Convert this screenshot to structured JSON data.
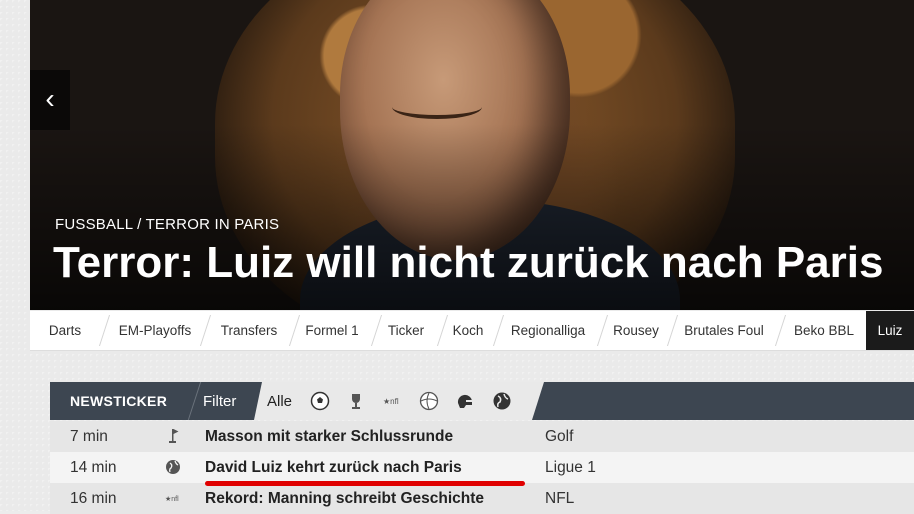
{
  "hero": {
    "prev_icon": "‹",
    "kicker": "FUSSBALL / TERROR IN PARIS",
    "title": "Terror: Luiz will nicht zurück nach Paris"
  },
  "tags": [
    "Darts",
    "EM-Playoffs",
    "Transfers",
    "Formel 1",
    "Ticker",
    "Koch",
    "Regionalliga",
    "Rousey",
    "Brutales Foul",
    "Beko BBL",
    "Luiz"
  ],
  "ticker": {
    "title": "NEWSTICKER",
    "filter_label": "Filter",
    "filter_all": "Alle",
    "filter_icons": [
      "soccer-ball-icon",
      "europa-league-icon",
      "nfl-icon",
      "volleyball-icon",
      "helmet-icon",
      "globe-icon"
    ],
    "rows": [
      {
        "time": "7 min",
        "icon": "golf-icon",
        "headline": "Masson mit starker Schlussrunde",
        "category": "Golf"
      },
      {
        "time": "14 min",
        "icon": "globe-icon",
        "headline": "David Luiz kehrt zurück nach Paris",
        "category": "Ligue 1"
      },
      {
        "time": "16 min",
        "icon": "nfl-icon",
        "headline": "Rekord: Manning schreibt Geschichte",
        "category": "NFL"
      }
    ]
  },
  "colors": {
    "ticker_header": "#3d4651",
    "active_tag": "#1b1b1b",
    "annotation": "#e00000"
  }
}
